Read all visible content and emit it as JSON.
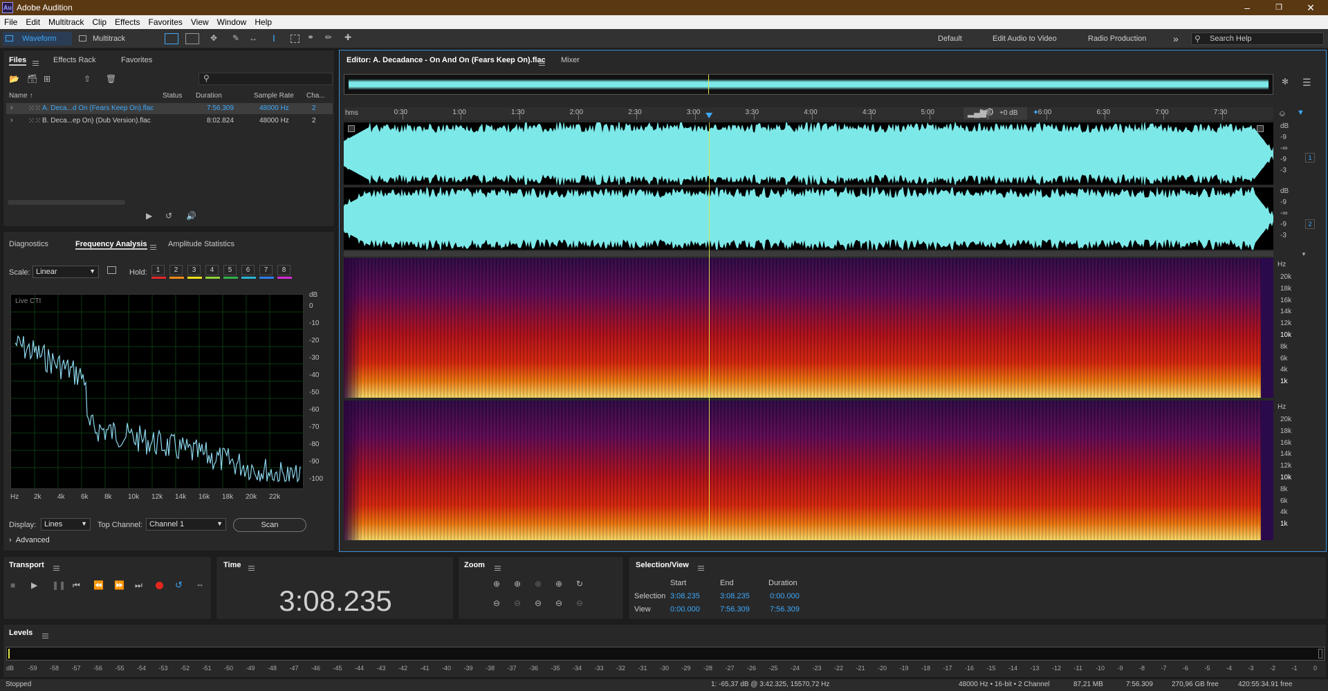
{
  "window": {
    "title": "Adobe Audition",
    "logo": "Au"
  },
  "menu": [
    "File",
    "Edit",
    "Multitrack",
    "Clip",
    "Effects",
    "Favorites",
    "View",
    "Window",
    "Help"
  ],
  "toolbar": {
    "waveform": "Waveform",
    "multitrack": "Multitrack",
    "workspaces": [
      "Default",
      "Edit Audio to Video",
      "Radio Production"
    ],
    "search_placeholder": "Search Help"
  },
  "files_panel": {
    "tabs": [
      "Files",
      "Effects Rack",
      "Favorites"
    ],
    "columns": [
      "Name",
      "Status",
      "Duration",
      "Sample Rate",
      "Cha..."
    ],
    "rows": [
      {
        "name": "A. Deca...d On (Fears Keep On).flac",
        "duration": "7:56.309",
        "rate": "48000 Hz",
        "ch": "2",
        "selected": true
      },
      {
        "name": "B. Deca...ep On) (Dub Version).flac",
        "duration": "8:02.824",
        "rate": "48000 Hz",
        "ch": "2",
        "selected": false
      }
    ]
  },
  "analysis_panel": {
    "tabs": [
      "Diagnostics",
      "Frequency Analysis",
      "Amplitude Statistics"
    ],
    "scale_label": "Scale:",
    "scale_value": "Linear",
    "hold_label": "Hold:",
    "hold_buttons": [
      "1",
      "2",
      "3",
      "4",
      "5",
      "6",
      "7",
      "8"
    ],
    "hold_colors": [
      "#e8262a",
      "#f58c1a",
      "#f2e21a",
      "#8ed43a",
      "#31b34b",
      "#29b6d6",
      "#2d7ef0",
      "#d62ad6"
    ],
    "plot_label": "Live CTI",
    "db_label": "dB",
    "db_ticks": [
      "0",
      "-10",
      "-20",
      "-30",
      "-40",
      "-50",
      "-60",
      "-70",
      "-80",
      "-90",
      "-100"
    ],
    "hz_ticks": [
      "Hz",
      "2k",
      "4k",
      "6k",
      "8k",
      "10k",
      "12k",
      "14k",
      "16k",
      "18k",
      "20k",
      "22k"
    ],
    "display_label": "Display:",
    "display_value": "Lines",
    "top_channel_label": "Top Channel:",
    "top_channel_value": "Channel 1",
    "scan_button": "Scan",
    "advanced": "Advanced"
  },
  "editor": {
    "tab": "Editor: A. Decadance - On And On (Fears Keep On).flac",
    "mixer_tab": "Mixer",
    "ruler_unit": "hms",
    "ruler_ticks": [
      "0:30",
      "1:00",
      "1:30",
      "2:00",
      "2:30",
      "3:00",
      "3:30",
      "4:00",
      "4:30",
      "5:00",
      "5:30",
      "6:00",
      "6:30",
      "7:00",
      "7:30"
    ],
    "gain": "+0 dB",
    "db_scale": [
      "dB",
      "-9",
      "-∞",
      "-9",
      "-3"
    ],
    "channel_labels": [
      "1",
      "2"
    ],
    "hz_scale": [
      "Hz",
      "20k",
      "18k",
      "16k",
      "14k",
      "12k",
      "10k",
      "8k",
      "6k",
      "4k",
      "1k"
    ],
    "waveform_color": "#7de8e8",
    "playhead_fraction": 0.393
  },
  "transport": {
    "title": "Transport"
  },
  "time": {
    "title": "Time",
    "value": "3:08.235"
  },
  "zoom": {
    "title": "Zoom"
  },
  "selection": {
    "title": "Selection/View",
    "headers": [
      "Start",
      "End",
      "Duration"
    ],
    "rows": [
      {
        "label": "Selection",
        "start": "3:08.235",
        "end": "3:08.235",
        "duration": "0:00.000"
      },
      {
        "label": "View",
        "start": "0:00.000",
        "end": "7:56.309",
        "duration": "7:56.309"
      }
    ]
  },
  "levels": {
    "title": "Levels",
    "ticks": [
      "dB",
      "-59",
      "-58",
      "-57",
      "-56",
      "-55",
      "-54",
      "-53",
      "-52",
      "-51",
      "-50",
      "-49",
      "-48",
      "-47",
      "-46",
      "-45",
      "-44",
      "-43",
      "-42",
      "-41",
      "-40",
      "-39",
      "-38",
      "-37",
      "-36",
      "-35",
      "-34",
      "-33",
      "-32",
      "-31",
      "-30",
      "-29",
      "-28",
      "-27",
      "-26",
      "-25",
      "-24",
      "-23",
      "-22",
      "-21",
      "-20",
      "-19",
      "-18",
      "-17",
      "-16",
      "-15",
      "-14",
      "-13",
      "-12",
      "-11",
      "-10",
      "-9",
      "-8",
      "-7",
      "-6",
      "-5",
      "-4",
      "-3",
      "-2",
      "-1",
      "0"
    ]
  },
  "status": {
    "state": "Stopped",
    "cursor": "1: -65,37 dB @ 3:42.325, 15570,72 Hz",
    "format": "48000 Hz • 16-bit • 2 Channel",
    "size": "87,21 MB",
    "duration": "7:56.309",
    "free": "270,96 GB free",
    "free_time": "420:55:34.91 free"
  }
}
